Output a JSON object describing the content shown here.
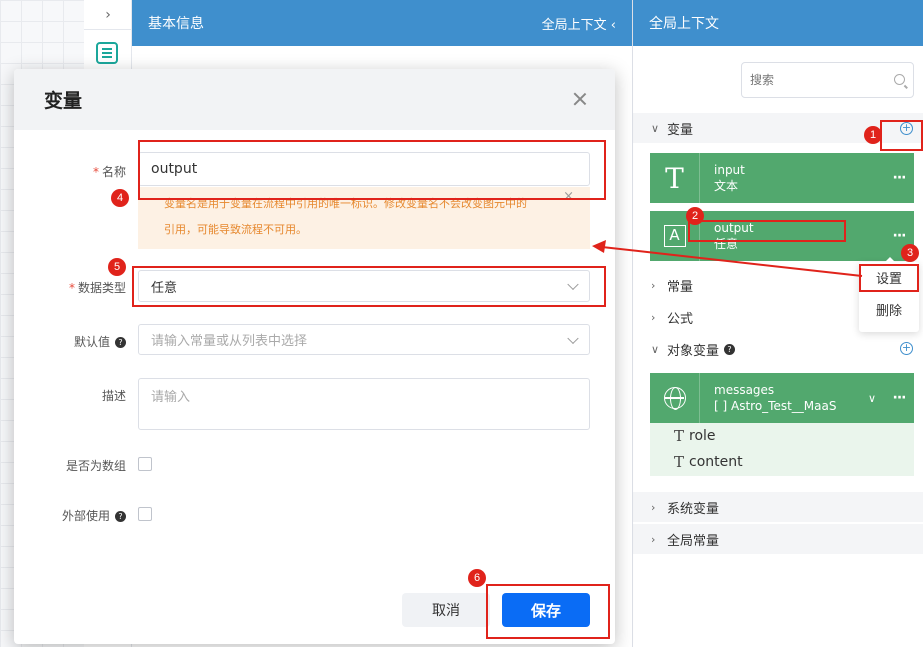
{
  "mid_panel": {
    "title": "基本信息",
    "context_link": "全局上下文 ‹"
  },
  "right_panel": {
    "title": "全局上下文",
    "search_placeholder": "搜索",
    "sections": {
      "variables": "变量",
      "constants": "常量",
      "formulas": "公式",
      "object_variables": "对象变量",
      "system_variables": "系统变量",
      "global_constants": "全局常量"
    },
    "variables": [
      {
        "name": "input",
        "type": "文本",
        "icon": "text-icon"
      },
      {
        "name": "output",
        "type": "任意",
        "icon": "any-type-icon"
      }
    ],
    "object_variable": {
      "name": "messages",
      "type": "[ ] Astro_Test__MaaS",
      "icon": "globe-icon",
      "fields": [
        "role",
        "content"
      ]
    },
    "context_menu": {
      "settings": "设置",
      "delete": "删除"
    },
    "more_icon": "···",
    "help_icon": "?"
  },
  "dialog": {
    "title": "变量",
    "name_label": "名称",
    "name_value": "output",
    "name_warning_line1": "变量名是用于变量在流程中引用的唯一标识。修改变量名不会改变图元中的",
    "name_warning_line2": "引用，可能导致流程不可用。",
    "data_type_label": "数据类型",
    "data_type_value": "任意",
    "default_label": "默认值",
    "default_placeholder": "请输入常量或从列表中选择",
    "desc_label": "描述",
    "desc_placeholder": "请输入",
    "is_array_label": "是否为数组",
    "external_label": "外部使用",
    "cancel": "取消",
    "save": "保存",
    "required_mark": "*",
    "help_icon": "?"
  },
  "annotations": [
    "1",
    "2",
    "3",
    "4",
    "5",
    "6"
  ],
  "colors": {
    "header": "#3f8fcd",
    "card": "#52a86e",
    "primary": "#0a6cf5",
    "annotation": "#e0231b",
    "warning": "#e6882e"
  }
}
